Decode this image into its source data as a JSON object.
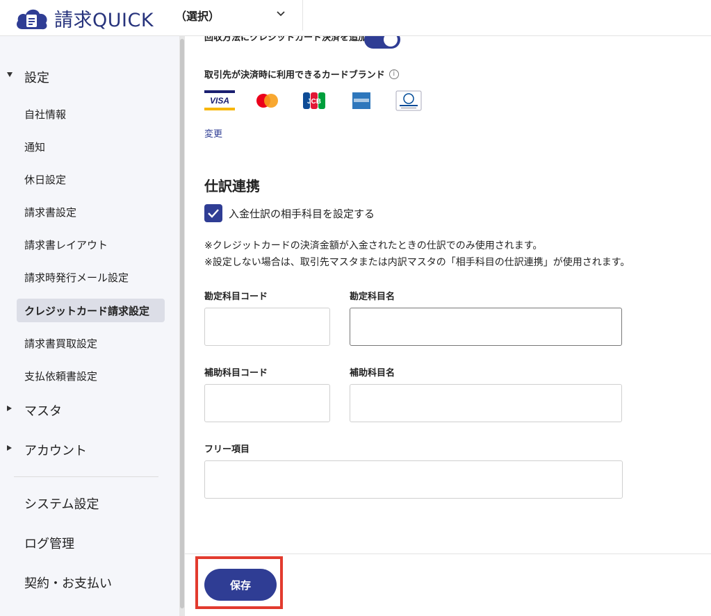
{
  "header": {
    "logo_text": "請求QUICK",
    "company_select": "（選択）"
  },
  "sidebar": {
    "settings_group": "設定",
    "items": [
      {
        "label": "自社情報"
      },
      {
        "label": "通知"
      },
      {
        "label": "休日設定"
      },
      {
        "label": "請求書設定"
      },
      {
        "label": "請求書レイアウト"
      },
      {
        "label": "請求時発行メール設定"
      },
      {
        "label": "クレジットカード請求設定"
      },
      {
        "label": "請求書買取設定"
      },
      {
        "label": "支払依頼書設定"
      }
    ],
    "master_group": "マスタ",
    "account_group": "アカウント",
    "system_settings": "システム設定",
    "log_management": "ログ管理",
    "contract_payment": "契約・お支払い"
  },
  "main": {
    "toggle_label": "回収方法にクレジットカード決済を追加",
    "toggle_on": true,
    "brand_label": "取引先が決済時に利用できるカードブランド",
    "brands": [
      "VISA",
      "Mastercard",
      "JCB",
      "American Express",
      "Diners Club"
    ],
    "change_link": "変更",
    "section_title": "仕訳連携",
    "checkbox_label": "入金仕訳の相手科目を設定する",
    "checkbox_checked": true,
    "note1": "※クレジットカードの決済金額が入金されたときの仕訳でのみ使用されます。",
    "note2": "※設定しない場合は、取引先マスタまたは内訳マスタの「相手科目の仕訳連携」が使用されます。",
    "account_code_label": "勘定科目コード",
    "account_name_label": "勘定科目名",
    "sub_code_label": "補助科目コード",
    "sub_name_label": "補助科目名",
    "free_item_label": "フリー項目"
  },
  "footer": {
    "save_label": "保存"
  },
  "colors": {
    "brand": "#2f3d94",
    "highlight": "#e23b2e"
  }
}
